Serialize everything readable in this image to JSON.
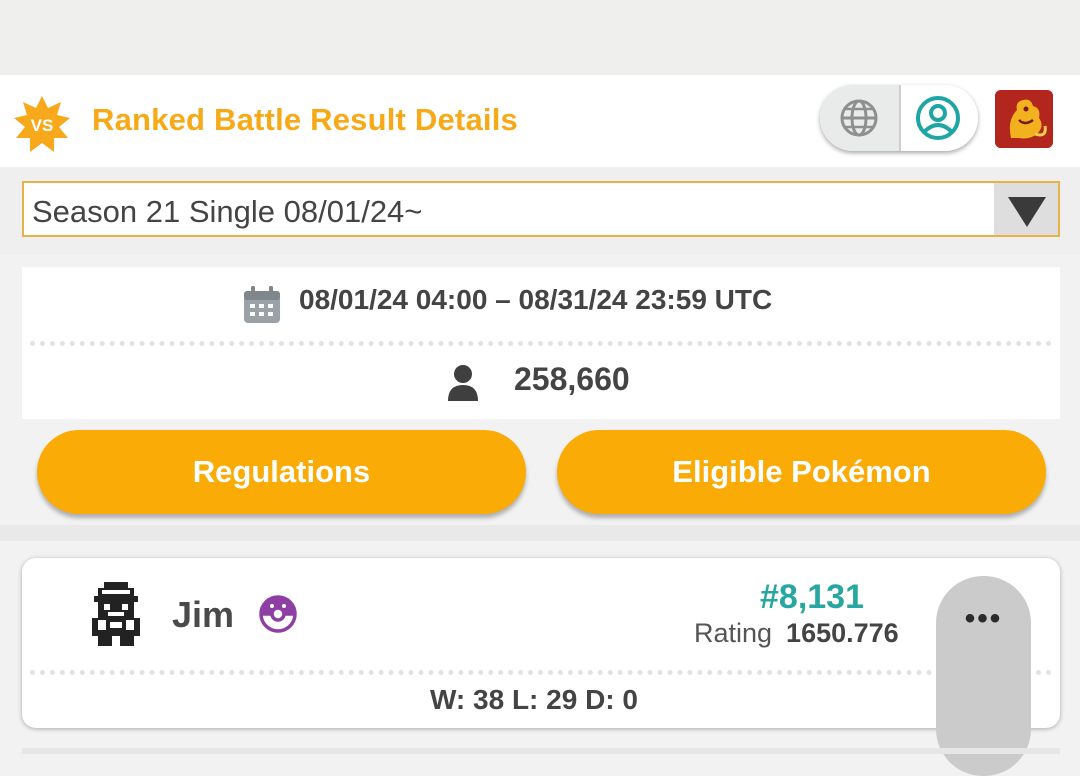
{
  "header": {
    "badge_label": "VS",
    "title": "Ranked Battle Result Details",
    "globe_icon": "globe-icon",
    "profile_icon": "user-circle-icon",
    "game_icon": "game-logo-icon"
  },
  "season_select": {
    "value": "Season 21 Single 08/01/24~",
    "arrow_icon": "dropdown-triangle-icon"
  },
  "season_info": {
    "date_range": "08/01/24 04:00 – 08/31/24 23:59 UTC",
    "player_count": "258,660",
    "calendar_icon": "calendar-icon",
    "person_icon": "person-icon"
  },
  "buttons": {
    "regulations": "Regulations",
    "eligible_pokemon": "Eligible Pokémon"
  },
  "player": {
    "name": "Jim",
    "rank": "#8,131",
    "rating_label": "Rating",
    "rating_value": "1650.776",
    "record": "W: 38 L: 29 D: 0",
    "ball_icon": "master-ball-icon",
    "more_label": "•••"
  },
  "colors": {
    "accent": "#faab05",
    "title": "#f7a918",
    "rank": "#28a6a2",
    "text": "#444444"
  }
}
